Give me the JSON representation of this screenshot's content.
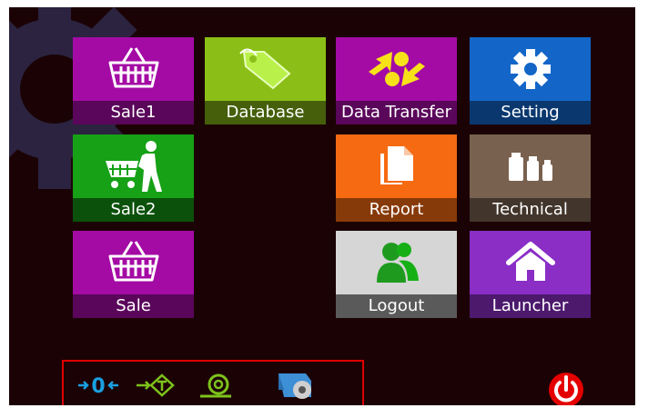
{
  "tiles": {
    "sale1": {
      "label": "Sale1",
      "icon": "basket-icon",
      "color": "#a40ba4"
    },
    "database": {
      "label": "Database",
      "icon": "tag-icon",
      "color": "#8bbf17"
    },
    "data_transfer": {
      "label": "Data Transfer",
      "icon": "transfer-arrows-icon",
      "color": "#a40ba4"
    },
    "setting": {
      "label": "Setting",
      "icon": "gear-icon",
      "color": "#1366c8"
    },
    "sale2": {
      "label": "Sale2",
      "icon": "shopper-cart-icon",
      "color": "#16a116"
    },
    "report": {
      "label": "Report",
      "icon": "copy-pages-icon",
      "color": "#f66a12"
    },
    "technical": {
      "label": "Technical",
      "icon": "weights-icon",
      "color": "#79614f"
    },
    "sale": {
      "label": "Sale",
      "icon": "basket-icon",
      "color": "#a40ba4"
    },
    "logout": {
      "label": "Logout",
      "icon": "users-icon",
      "color": "#d6d6d6"
    },
    "launcher": {
      "label": "Launcher",
      "icon": "home-icon",
      "color": "#8a2ec6"
    }
  },
  "bottom_bar": {
    "icons": [
      "zero-icon",
      "tare-icon",
      "paper-roll-icon",
      "printer-roll-icon"
    ],
    "zero_text": "0"
  },
  "power": {
    "icon": "power-icon",
    "color": "#e50000"
  }
}
